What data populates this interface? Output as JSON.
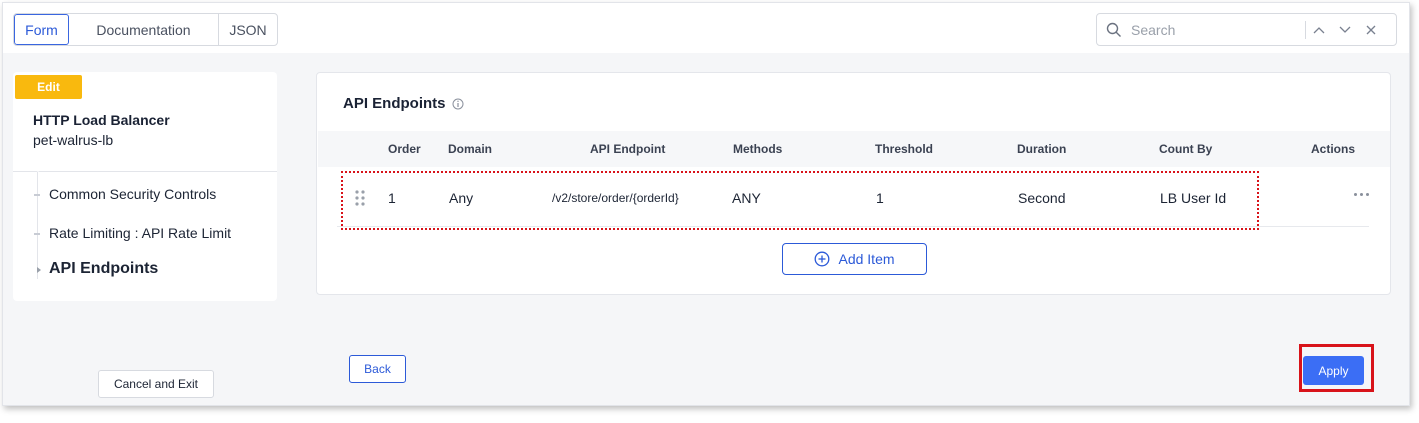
{
  "tabs": [
    {
      "label": "Form",
      "active": true
    },
    {
      "label": "Documentation",
      "active": false
    },
    {
      "label": "JSON",
      "active": false
    }
  ],
  "search": {
    "placeholder": "Search"
  },
  "sidenav": {
    "badge": "Edit",
    "title": "HTTP Load Balancer",
    "subtitle": "pet-walrus-lb",
    "items": [
      {
        "label": "Common Security Controls",
        "active": false
      },
      {
        "label": "Rate Limiting : API Rate Limit",
        "active": false
      },
      {
        "label": "API Endpoints",
        "active": true
      }
    ],
    "cancel_label": "Cancel and Exit"
  },
  "card": {
    "title": "API Endpoints",
    "columns": [
      "Order",
      "Domain",
      "API Endpoint",
      "Methods",
      "Threshold",
      "Duration",
      "Count By",
      "Actions"
    ],
    "rows": [
      {
        "order": "1",
        "domain": "Any",
        "endpoint": "/v2/store/order/{orderId}",
        "methods": "ANY",
        "threshold": "1",
        "duration": "Second",
        "count_by": "LB User Id"
      }
    ],
    "add_label": "Add Item"
  },
  "footer": {
    "back_label": "Back",
    "apply_label": "Apply"
  },
  "colors": {
    "accent": "#2c5ad8",
    "apply": "#3b6ef5",
    "badge": "#f9b90e",
    "highlight": "#d8131a"
  }
}
